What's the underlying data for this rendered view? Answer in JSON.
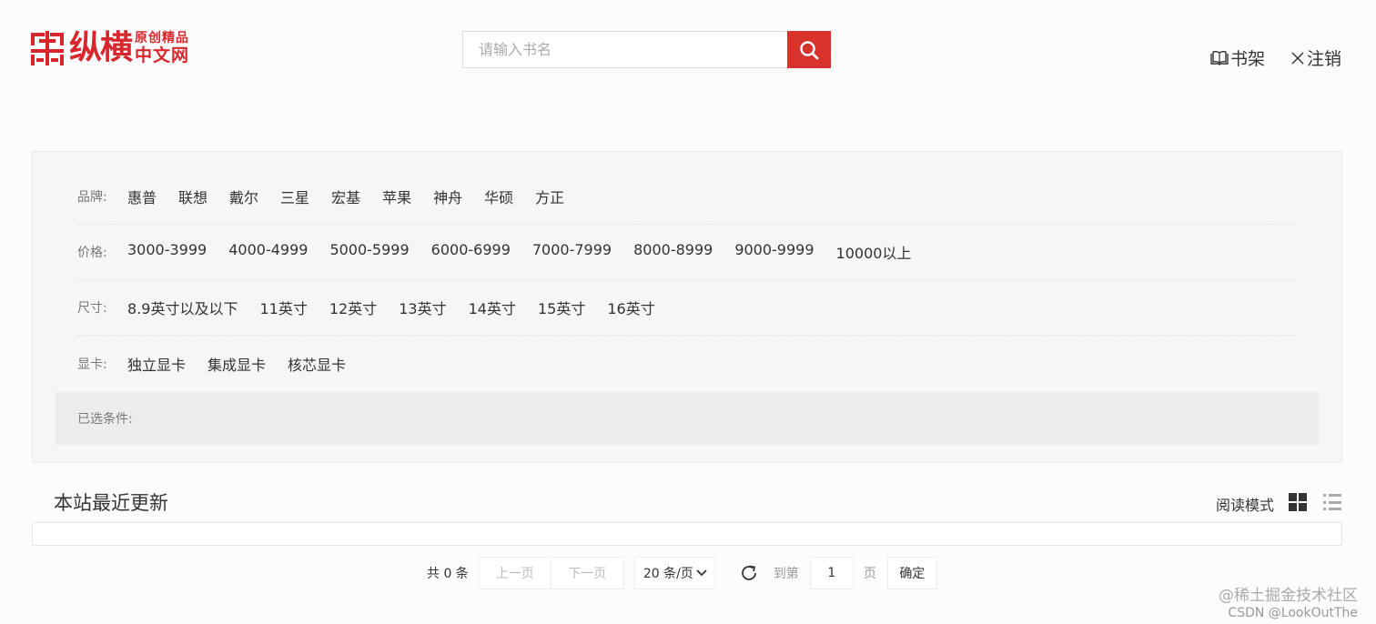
{
  "brand": {
    "main": "纵横",
    "side_top": "原创精品",
    "side_bottom": "中文网",
    "color": "#d8262c"
  },
  "search": {
    "placeholder": "请输入书名",
    "button_icon": "search-icon",
    "button_color": "#d8322c"
  },
  "top_links": {
    "bookshelf": "书架",
    "logout": "注销"
  },
  "filters": {
    "brand": {
      "label": "品牌:",
      "options": [
        "惠普",
        "联想",
        "戴尔",
        "三星",
        "宏基",
        "苹果",
        "神舟",
        "华硕",
        "方正"
      ]
    },
    "price": {
      "label": "价格:",
      "options": [
        "3000-3999",
        "4000-4999",
        "5000-5999",
        "6000-6999",
        "7000-7999",
        "8000-8999",
        "9000-9999",
        "10000以上"
      ]
    },
    "size": {
      "label": "尺寸:",
      "options": [
        "8.9英寸以及以下",
        "11英寸",
        "12英寸",
        "13英寸",
        "14英寸",
        "15英寸",
        "16英寸"
      ]
    },
    "gpu": {
      "label": "显卡:",
      "options": [
        "独立显卡",
        "集成显卡",
        "核芯显卡"
      ]
    },
    "selected_label": "已选条件:"
  },
  "recent": {
    "title": "本站最近更新",
    "read_mode_label": "阅读模式"
  },
  "pagination": {
    "total": "共 0 条",
    "prev": "上一页",
    "next": "下一页",
    "page_size": "20 条/页",
    "goto": "到第",
    "page_value": "1",
    "page_unit": "页",
    "confirm": "确定"
  },
  "watermark": {
    "line1": "@稀土掘金技术社区",
    "line2": "CSDN @LookOutThe"
  }
}
